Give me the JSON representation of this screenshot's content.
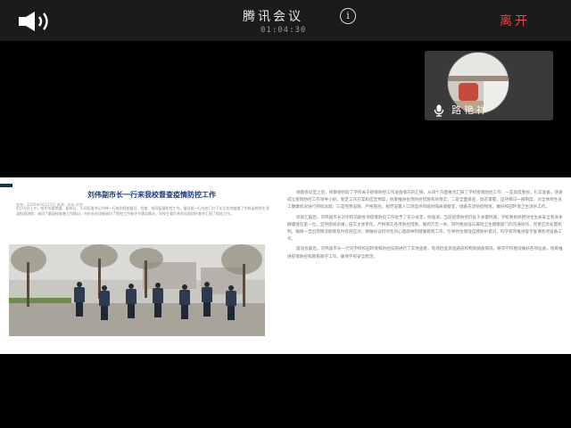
{
  "meeting": {
    "title": "腾讯会议",
    "timer": "01:04:30",
    "leave_label": "离开",
    "info_symbol": "i",
    "speaker_icon": "speaker-icon",
    "accent_color": "#e64340"
  },
  "participant": {
    "name": "路艳祥",
    "mic_icon": "microphone-icon"
  },
  "shared_doc": {
    "title": "刘伟副市长一行来我校督查疫情防控工作",
    "meta": "发布：2020年04月12日  来源：本站  浏览：",
    "intro": "4月10日上午，哈尔市委常委、副市长、大同区委书记刘伟一行来到我校督导、检查、指导疫情防控工作。督导组一行在校门口下车后实地查看了学校返校师生测温检测流程，询问了解返校准备工作情况，刘市长还详细询问了防控工作各环节落实情况，学校主要负责同志陪同检查并汇报了相关工作。",
    "right_paragraphs": [
      "视察会议室之后，视察组听取了学校关于疫情防控工作准备情况的汇报，从四个方面重点汇报了学校疫情防控工作：一是高度重视，扎实准备，快速成立疫情防控工作领导小组，制定工作方案和应急预案，统筹推进各项防控措施有效落实；二是全面排查，动态掌握，坚持每日一报制度，对全体师生员工健康状况进行持续追踪；三是完善设施，严格管控，规范设置入口测温点和临时隔离观察室，储备充足防疫物资，做好校园环境卫生消杀工作。",
      "听取汇报后，刘伟副市长对学校前期各项疫情防控工作给予了充分肯定，他强调，当前疫情防控仍处于关键时期，学校要始终把师生生命安全和身体健康放在第一位，坚持底线思维，压实主体责任，严格落实各项防控措施，做到万无一失。同时要加强与属地卫生健康部门的沟通协作，完善应急处置机制，确保一旦出现情况能够及时有效应对；要做好返校师生的心理疏导和健康教育工作，引导师生增强自我防护意识，科学有序推进复学复课各项准备工作。",
      "座谈会最后，刘伟副市长一行对学校校园环境和防控设施进行了实地查看，现场检查测温通道和物资储备情况，要求学校继续做好各项准备，统筹推进疫情防控和教育教学工作，确保学校安全稳定。"
    ]
  }
}
